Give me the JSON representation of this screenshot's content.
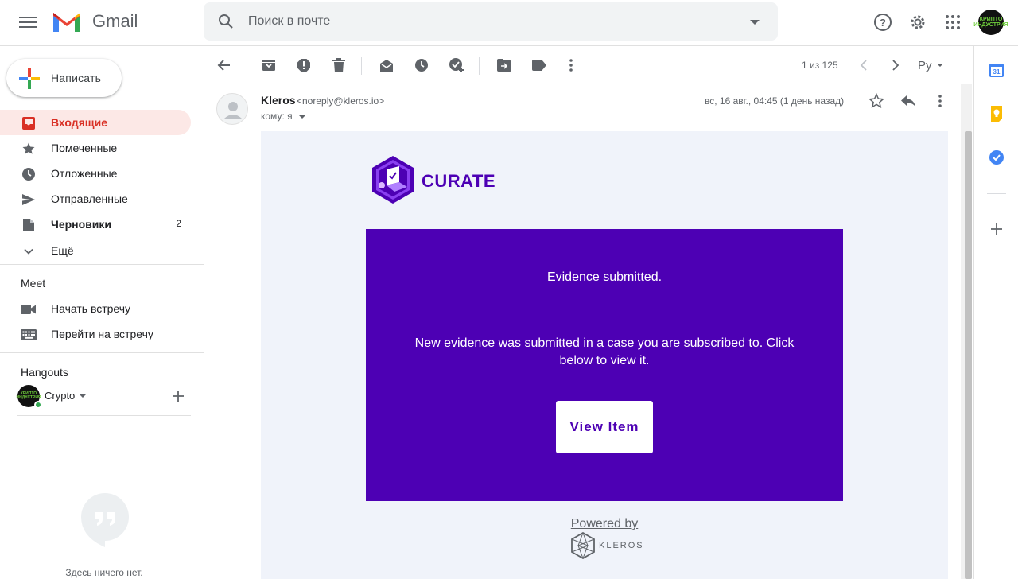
{
  "header": {
    "app_name": "Gmail",
    "search_placeholder": "Поиск в почте",
    "avatar_text": "КРИПТО ИНДУСТРИЯ"
  },
  "sidebar": {
    "compose_label": "Написать",
    "items": [
      {
        "label": "Входящие",
        "icon": "inbox-icon",
        "count": ""
      },
      {
        "label": "Помеченные",
        "icon": "star-icon",
        "count": ""
      },
      {
        "label": "Отложенные",
        "icon": "clock-icon",
        "count": ""
      },
      {
        "label": "Отправленные",
        "icon": "send-icon",
        "count": ""
      },
      {
        "label": "Черновики",
        "icon": "draft-icon",
        "count": "2"
      },
      {
        "label": "Ещё",
        "icon": "chevron-down-icon",
        "count": ""
      }
    ],
    "meet": {
      "title": "Meet",
      "items": [
        {
          "label": "Начать встречу",
          "icon": "video-icon"
        },
        {
          "label": "Перейти на встречу",
          "icon": "keyboard-icon"
        }
      ]
    },
    "hangouts": {
      "title": "Hangouts",
      "user_name": "Crypto",
      "avatar_text": "КРИПТО ИНДУСТРИЯ",
      "empty_text": "Здесь ничего нет."
    }
  },
  "toolbar": {
    "pager": "1 из 125",
    "lang": "Ру"
  },
  "message": {
    "sender_name": "Kleros",
    "sender_email": "<noreply@kleros.io>",
    "to": "кому: я",
    "date": "вс, 16 авг., 04:45 (1 день назад)"
  },
  "email": {
    "brand": "CURATE",
    "title": "Evidence submitted.",
    "body": "New evidence was submitted in a case you are subscribed to. Click below to view it.",
    "button": "View Item",
    "powered_by": "Powered by",
    "footer_brand": "KLEROS",
    "colors": {
      "brand_purple": "#4d00b4",
      "background": "#f0f3fa"
    }
  }
}
